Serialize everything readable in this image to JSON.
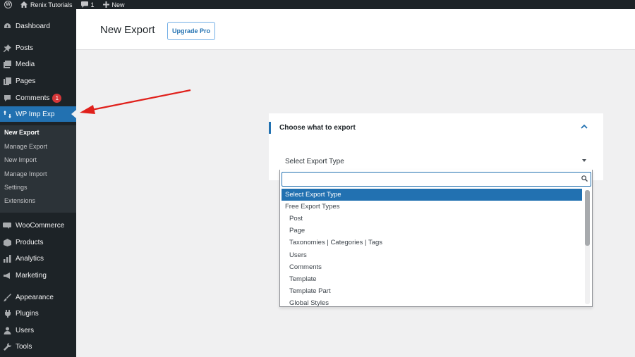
{
  "admin_bar": {
    "site_name": "Renix Tutorials",
    "comments_count": "1",
    "new_label": "New"
  },
  "sidebar": {
    "items": [
      {
        "label": "Dashboard",
        "icon": "dashboard-icon"
      },
      {
        "label": "Posts",
        "icon": "pin-icon"
      },
      {
        "label": "Media",
        "icon": "media-icon"
      },
      {
        "label": "Pages",
        "icon": "pages-icon"
      },
      {
        "label": "Comments",
        "icon": "comment-icon",
        "badge": "1"
      },
      {
        "label": "WP Imp Exp",
        "icon": "import-export-icon",
        "active": true
      },
      {
        "label": "WooCommerce",
        "icon": "woocommerce-icon"
      },
      {
        "label": "Products",
        "icon": "products-icon"
      },
      {
        "label": "Analytics",
        "icon": "analytics-icon"
      },
      {
        "label": "Marketing",
        "icon": "megaphone-icon"
      },
      {
        "label": "Appearance",
        "icon": "brush-icon"
      },
      {
        "label": "Plugins",
        "icon": "plugin-icon"
      },
      {
        "label": "Users",
        "icon": "users-icon"
      },
      {
        "label": "Tools",
        "icon": "wrench-icon"
      }
    ],
    "submenu": [
      {
        "label": "New Export",
        "current": true
      },
      {
        "label": "Manage Export"
      },
      {
        "label": "New Import"
      },
      {
        "label": "Manage Import"
      },
      {
        "label": "Settings"
      },
      {
        "label": "Extensions"
      }
    ]
  },
  "header": {
    "title": "New Export",
    "upgrade_label": "Upgrade Pro"
  },
  "panel": {
    "title": "Choose what to export",
    "select_value": "Select Export Type"
  },
  "dropdown": {
    "search_value": "",
    "options": [
      {
        "label": "Select Export Type",
        "highlight": true
      },
      {
        "label": "Free Export Types",
        "group": true
      },
      {
        "label": "Post"
      },
      {
        "label": "Page"
      },
      {
        "label": "Taxonomies | Categories | Tags"
      },
      {
        "label": "Users"
      },
      {
        "label": "Comments"
      },
      {
        "label": "Template"
      },
      {
        "label": "Template Part"
      },
      {
        "label": "Global Styles"
      }
    ]
  },
  "colors": {
    "admin_dark": "#1d2327",
    "submenu_bg": "#2c3338",
    "accent": "#2271b1",
    "badge": "#d63638",
    "annotation_arrow": "#e0201b"
  }
}
